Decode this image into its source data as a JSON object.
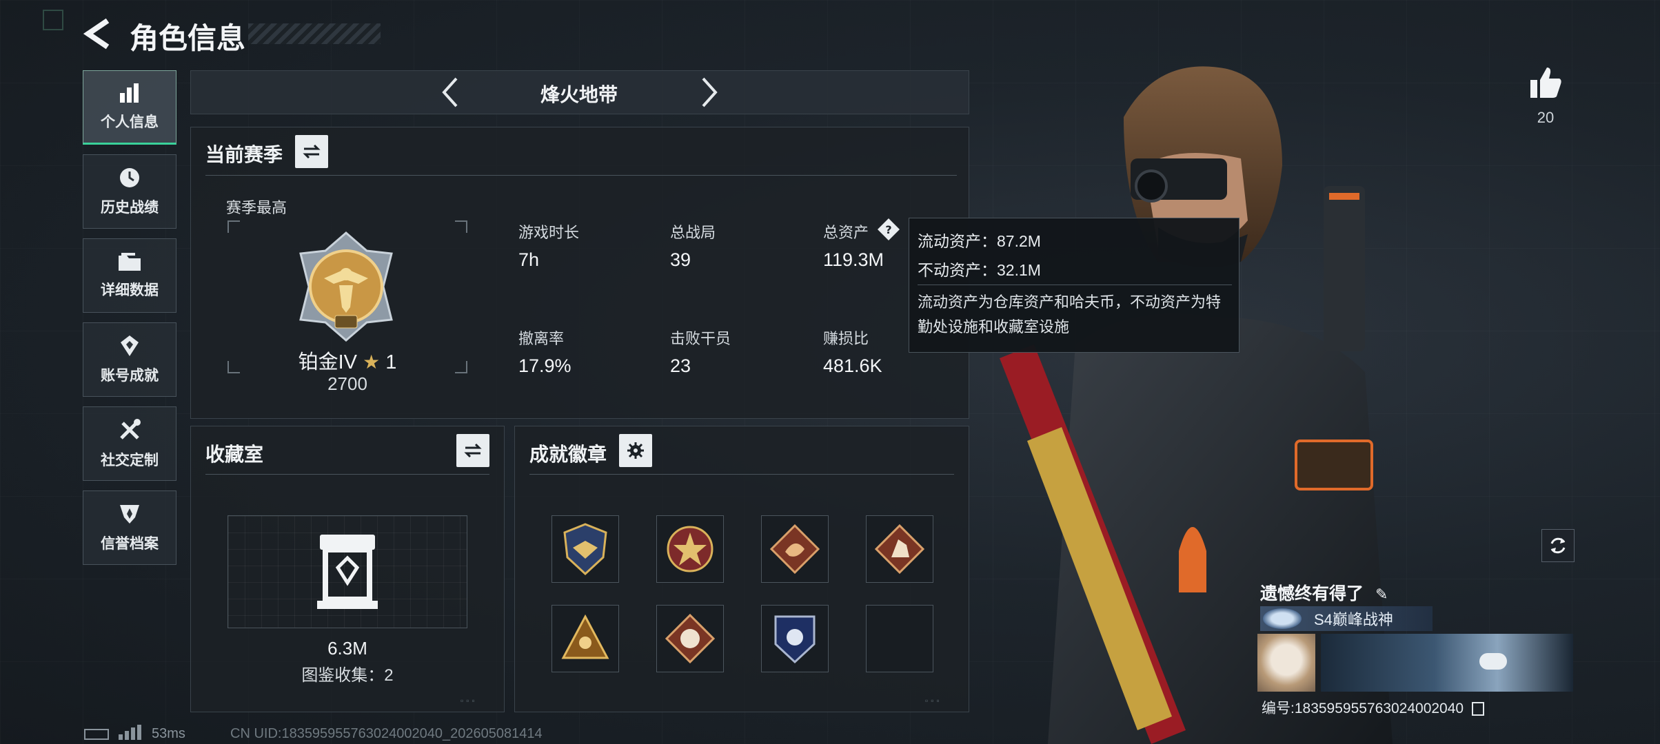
{
  "header": {
    "title": "角色信息"
  },
  "sidebar": {
    "items": [
      {
        "label": "个人信息",
        "icon": "bar-chart-icon"
      },
      {
        "label": "历史战绩",
        "icon": "clock-icon"
      },
      {
        "label": "详细数据",
        "icon": "folder-icon"
      },
      {
        "label": "账号成就",
        "icon": "achievement-icon"
      },
      {
        "label": "社交定制",
        "icon": "tools-icon"
      },
      {
        "label": "信誉档案",
        "icon": "shield-icon"
      }
    ]
  },
  "mode_selector": {
    "label": "烽火地带"
  },
  "season": {
    "title": "当前赛季",
    "highest_label": "赛季最高",
    "rank_name": "铂金IV",
    "rank_stars": "1",
    "rank_score": "2700",
    "stats": {
      "play_time": {
        "label": "游戏时长",
        "value": "7h"
      },
      "total_matches": {
        "label": "总战局",
        "value": "39"
      },
      "total_assets": {
        "label": "总资产",
        "value": "119.3M"
      },
      "evac_rate": {
        "label": "撤离率",
        "value": "17.9%"
      },
      "kills": {
        "label": "击败干员",
        "value": "23"
      },
      "profit_ratio": {
        "label": "赚损比",
        "value": "481.6K"
      }
    }
  },
  "tooltip": {
    "liquid": "流动资产：87.2M",
    "fixed": "不动资产：32.1M",
    "description": "流动资产为仓库资产和哈夫币，不动资产为特勤处设施和收藏室设施"
  },
  "collection": {
    "title": "收藏室",
    "value": "6.3M",
    "catalog": "图鉴收集：2"
  },
  "achievements": {
    "title": "成就徽章",
    "badges": [
      "eagle-badge-icon",
      "star-badge-icon",
      "dragon-badge-icon",
      "rider-badge-icon",
      "pyramid-badge-icon",
      "beast-badge-icon",
      "shield-badge-icon",
      "empty"
    ]
  },
  "likes": {
    "count": "20"
  },
  "profile_card": {
    "name": "遗憾终有得了",
    "title": "S4巅峰战神",
    "id_text": "编号:1835959557630240020​40"
  },
  "footer": {
    "ping": "53ms",
    "uid": "CN UID:183595955763024002040_202605081414"
  },
  "colors": {
    "accent": "#3ad29a",
    "gold": "#d9b25a",
    "tooltip_bg": "#14181c"
  }
}
